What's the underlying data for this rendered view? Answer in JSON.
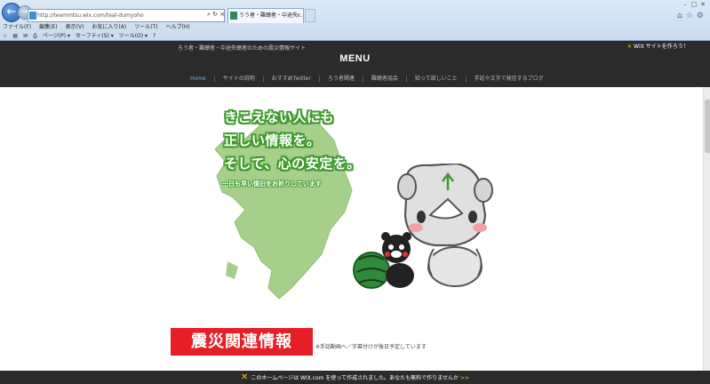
{
  "browser": {
    "address": "http://teammtsu.wix.com/teal-dumyoho",
    "tab_title": "うう者・難聴者・中途失...",
    "tab_close": "×",
    "menu": [
      "ファイル(F)",
      "編集(E)",
      "表示(V)",
      "お気に入り(A)",
      "ツール(T)",
      "ヘルプ(H)"
    ],
    "cmd": [
      "ページ(P) ▾",
      "セーフティ(S) ▾",
      "ツール(O) ▾"
    ]
  },
  "site": {
    "tagline": "ろう者・難聴者・中途失聴者のための震災情報サイト",
    "wix_link": "WIX サイトを作ろう！",
    "menu_title": "MENU",
    "nav": [
      "Home",
      "サイトの説明",
      "おすすめTwitter",
      "ろう者関連",
      "難聴者協会",
      "知って欲しいこと",
      "手話や文字で発信するブログ"
    ]
  },
  "hero": {
    "line1": "きこえない人にも",
    "line2": "正しい情報を。",
    "line3": "そして、心の安定を。",
    "sub": "一日も早い復旧をお祈りしています"
  },
  "section": {
    "banner": "震災関連情報",
    "note": "※手話動画へ／字幕付けが後日予定しています"
  },
  "footer": {
    "text": "このホームページは WIX.com を使って作成されました。あなたも無料で作りませんか",
    "arrow": ">>"
  },
  "colors": {
    "accent_green": "#3f9a2c",
    "banner_red": "#e61e25",
    "nav_active": "#6ab4ea",
    "wix_yellow": "#f5c400"
  }
}
